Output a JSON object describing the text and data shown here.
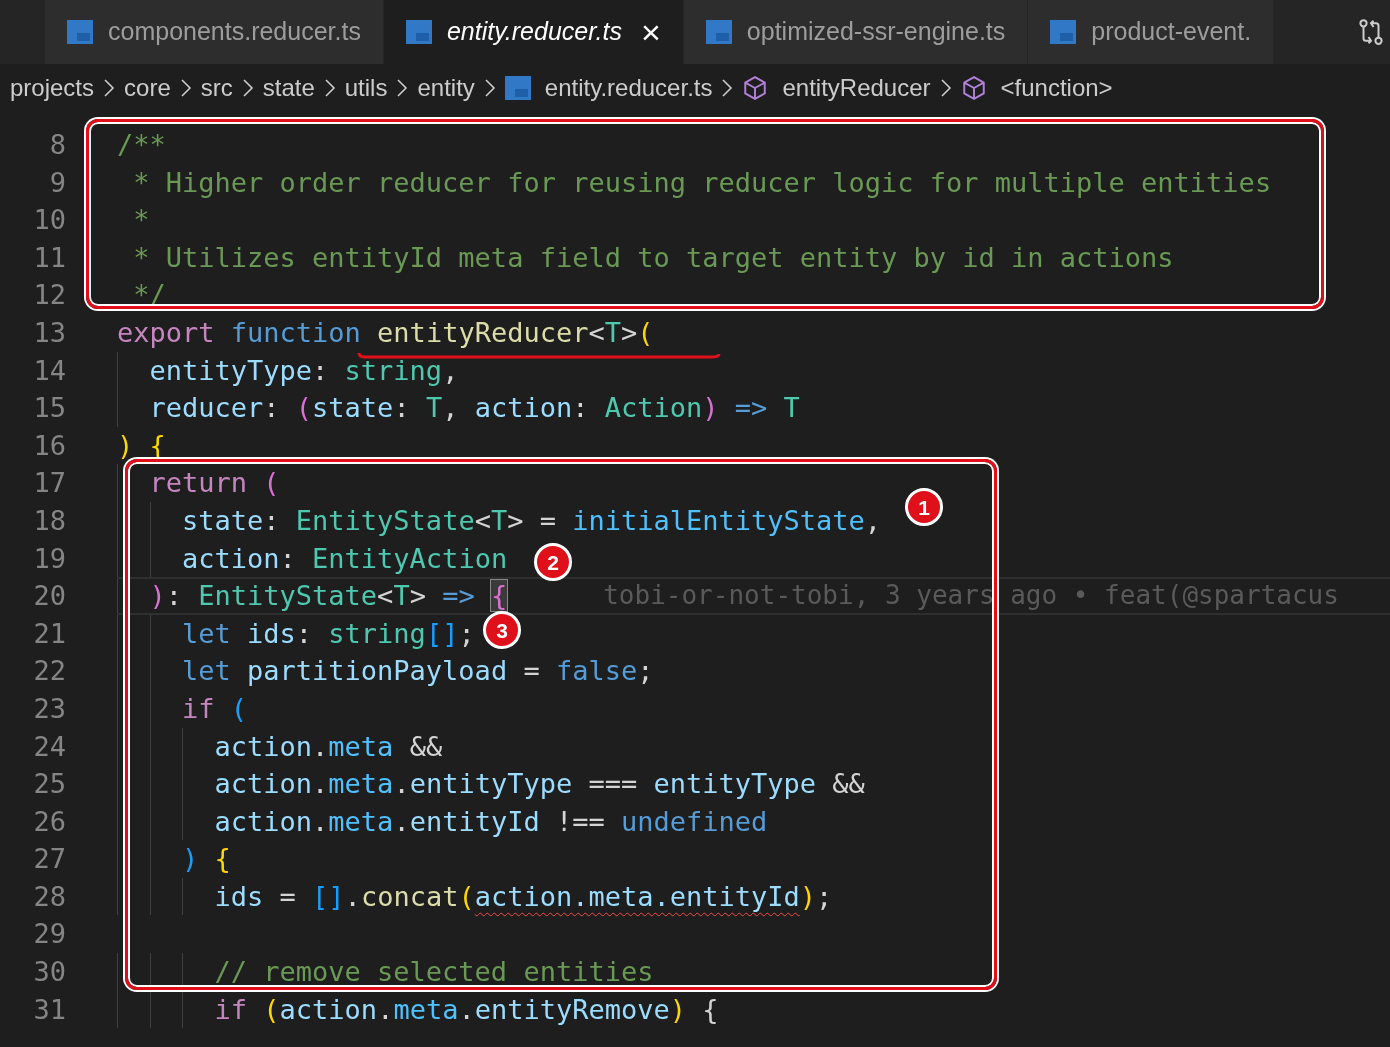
{
  "tabs": [
    {
      "label": "components.reducer.ts",
      "selected": false,
      "italic": false
    },
    {
      "label": "entity.reducer.ts",
      "selected": true,
      "italic": true,
      "close": "×"
    },
    {
      "label": "optimized-ssr-engine.ts",
      "selected": false,
      "italic": false
    },
    {
      "label": "product-event.",
      "selected": false,
      "italic": false
    }
  ],
  "breadcrumbs": [
    {
      "label": "projects",
      "kind": "folder"
    },
    {
      "label": "core",
      "kind": "folder"
    },
    {
      "label": "src",
      "kind": "folder"
    },
    {
      "label": "state",
      "kind": "folder"
    },
    {
      "label": "utils",
      "kind": "folder"
    },
    {
      "label": "entity",
      "kind": "folder"
    },
    {
      "label": "entity.reducer.ts",
      "kind": "file"
    },
    {
      "label": "entityReducer",
      "kind": "symbol"
    },
    {
      "label": "<function>",
      "kind": "symbol"
    }
  ],
  "lines": [
    {
      "number": "8",
      "tokens": [
        {
          "text": "/**",
          "kind": "comment"
        }
      ]
    },
    {
      "number": "9",
      "tokens": [
        {
          "text": " * Higher order reducer for reusing reducer logic for multiple entities",
          "kind": "comment"
        }
      ]
    },
    {
      "number": "10",
      "tokens": [
        {
          "text": " *",
          "kind": "comment"
        }
      ]
    },
    {
      "number": "11",
      "tokens": [
        {
          "text": " * Utilizes entityId meta field to target entity by id in actions",
          "kind": "comment"
        }
      ]
    },
    {
      "number": "12",
      "tokens": [
        {
          "text": " */",
          "kind": "comment"
        }
      ]
    },
    {
      "number": "13",
      "tokens": [
        {
          "text": "export ",
          "kind": "keyword"
        },
        {
          "text": "function ",
          "kind": "storage"
        },
        {
          "text": "entityReducer",
          "kind": "function"
        },
        {
          "text": "<",
          "kind": "punctuation"
        },
        {
          "text": "T",
          "kind": "type"
        },
        {
          "text": ">",
          "kind": "punctuation"
        },
        {
          "text": "(",
          "kind": "bracket-gold"
        }
      ]
    },
    {
      "number": "14",
      "tokens": [
        {
          "text": "  entityType",
          "kind": "variable"
        },
        {
          "text": ": ",
          "kind": "punctuation"
        },
        {
          "text": "string",
          "kind": "type"
        },
        {
          "text": ",",
          "kind": "punctuation"
        }
      ]
    },
    {
      "number": "15",
      "tokens": [
        {
          "text": "  reducer",
          "kind": "variable"
        },
        {
          "text": ": ",
          "kind": "punctuation"
        },
        {
          "text": "(",
          "kind": "bracket-pink"
        },
        {
          "text": "state",
          "kind": "variable"
        },
        {
          "text": ": ",
          "kind": "punctuation"
        },
        {
          "text": "T",
          "kind": "type"
        },
        {
          "text": ", ",
          "kind": "punctuation"
        },
        {
          "text": "action",
          "kind": "variable"
        },
        {
          "text": ": ",
          "kind": "punctuation"
        },
        {
          "text": "Action",
          "kind": "type"
        },
        {
          "text": ") ",
          "kind": "bracket-pink"
        },
        {
          "text": "=> ",
          "kind": "storage"
        },
        {
          "text": "T",
          "kind": "type"
        }
      ]
    },
    {
      "number": "16",
      "tokens": [
        {
          "text": ") ",
          "kind": "bracket-gold"
        },
        {
          "text": "{",
          "kind": "bracket-gold"
        }
      ]
    },
    {
      "number": "17",
      "tokens": [
        {
          "text": "  return ",
          "kind": "keyword"
        },
        {
          "text": "(",
          "kind": "bracket-pink"
        }
      ]
    },
    {
      "number": "18",
      "tokens": [
        {
          "text": "    state",
          "kind": "variable"
        },
        {
          "text": ": ",
          "kind": "punctuation"
        },
        {
          "text": "EntityState",
          "kind": "type"
        },
        {
          "text": "<",
          "kind": "punctuation"
        },
        {
          "text": "T",
          "kind": "type"
        },
        {
          "text": "> = ",
          "kind": "punctuation"
        },
        {
          "text": "initialEntityState",
          "kind": "constant"
        },
        {
          "text": ",",
          "kind": "punctuation"
        }
      ]
    },
    {
      "number": "19",
      "tokens": [
        {
          "text": "    action",
          "kind": "variable"
        },
        {
          "text": ": ",
          "kind": "punctuation"
        },
        {
          "text": "EntityAction",
          "kind": "type"
        }
      ]
    },
    {
      "number": "20",
      "current": true,
      "blame": "tobi-or-not-tobi, 3 years ago • feat(@spartacus",
      "tokens": [
        {
          "text": "  )",
          "kind": "bracket-pink"
        },
        {
          "text": ": ",
          "kind": "punctuation"
        },
        {
          "text": "EntityState",
          "kind": "type"
        },
        {
          "text": "<",
          "kind": "punctuation"
        },
        {
          "text": "T",
          "kind": "type"
        },
        {
          "text": "> ",
          "kind": "punctuation"
        },
        {
          "text": "=> ",
          "kind": "storage"
        },
        {
          "text": "{",
          "kind": "bracket-pink",
          "match": true
        }
      ]
    },
    {
      "number": "21",
      "tokens": [
        {
          "text": "    let ",
          "kind": "storage"
        },
        {
          "text": "ids",
          "kind": "variable"
        },
        {
          "text": ": ",
          "kind": "punctuation"
        },
        {
          "text": "string",
          "kind": "type"
        },
        {
          "text": "[]",
          "kind": "bracket-blue"
        },
        {
          "text": ";",
          "kind": "punctuation"
        }
      ]
    },
    {
      "number": "22",
      "tokens": [
        {
          "text": "    let ",
          "kind": "storage"
        },
        {
          "text": "partitionPayload",
          "kind": "variable"
        },
        {
          "text": " = ",
          "kind": "punctuation"
        },
        {
          "text": "false",
          "kind": "storage"
        },
        {
          "text": ";",
          "kind": "punctuation"
        }
      ]
    },
    {
      "number": "23",
      "tokens": [
        {
          "text": "    if ",
          "kind": "keyword"
        },
        {
          "text": "(",
          "kind": "bracket-blue"
        }
      ]
    },
    {
      "number": "24",
      "tokens": [
        {
          "text": "      action",
          "kind": "variable"
        },
        {
          "text": ".",
          "kind": "punctuation"
        },
        {
          "text": "meta",
          "kind": "constant"
        },
        {
          "text": " &&",
          "kind": "punctuation"
        }
      ]
    },
    {
      "number": "25",
      "tokens": [
        {
          "text": "      action",
          "kind": "variable"
        },
        {
          "text": ".",
          "kind": "punctuation"
        },
        {
          "text": "meta",
          "kind": "constant"
        },
        {
          "text": ".",
          "kind": "punctuation"
        },
        {
          "text": "entityType",
          "kind": "variable"
        },
        {
          "text": " === ",
          "kind": "punctuation"
        },
        {
          "text": "entityType",
          "kind": "variable"
        },
        {
          "text": " &&",
          "kind": "punctuation"
        }
      ]
    },
    {
      "number": "26",
      "tokens": [
        {
          "text": "      action",
          "kind": "variable"
        },
        {
          "text": ".",
          "kind": "punctuation"
        },
        {
          "text": "meta",
          "kind": "constant"
        },
        {
          "text": ".",
          "kind": "punctuation"
        },
        {
          "text": "entityId",
          "kind": "variable"
        },
        {
          "text": " !== ",
          "kind": "punctuation"
        },
        {
          "text": "undefined",
          "kind": "storage"
        }
      ]
    },
    {
      "number": "27",
      "tokens": [
        {
          "text": "    ) ",
          "kind": "bracket-blue"
        },
        {
          "text": "{",
          "kind": "bracket-gold"
        }
      ]
    },
    {
      "number": "28",
      "tokens": [
        {
          "text": "      ids",
          "kind": "variable"
        },
        {
          "text": " = ",
          "kind": "punctuation"
        },
        {
          "text": "[]",
          "kind": "bracket-blue"
        },
        {
          "text": ".",
          "kind": "punctuation"
        },
        {
          "text": "concat",
          "kind": "function"
        },
        {
          "text": "(",
          "kind": "bracket-gold"
        },
        {
          "text": "action.meta.entityId",
          "kind": "variable",
          "squiggle": true
        },
        {
          "text": ")",
          "kind": "bracket-gold"
        },
        {
          "text": ";",
          "kind": "punctuation"
        }
      ]
    },
    {
      "number": "29"
    },
    {
      "number": "30",
      "tokens": [
        {
          "text": "      // remove selected entities",
          "kind": "comment"
        }
      ]
    },
    {
      "number": "31",
      "tokens": [
        {
          "text": "      if ",
          "kind": "keyword"
        },
        {
          "text": "(",
          "kind": "bracket-gold"
        },
        {
          "text": "action",
          "kind": "variable"
        },
        {
          "text": ".",
          "kind": "punctuation"
        },
        {
          "text": "meta",
          "kind": "constant"
        },
        {
          "text": ".",
          "kind": "punctuation"
        },
        {
          "text": "entityRemove",
          "kind": "variable"
        },
        {
          "text": ")",
          "kind": "bracket-gold"
        },
        {
          "text": " {",
          "kind": "punctuation"
        }
      ]
    }
  ],
  "annotations": [
    {
      "kind": "box"
    },
    {
      "kind": "underline"
    },
    {
      "kind": "box"
    },
    {
      "kind": "marker",
      "label": "1"
    },
    {
      "kind": "marker",
      "label": "2"
    },
    {
      "kind": "marker",
      "label": "3"
    }
  ]
}
